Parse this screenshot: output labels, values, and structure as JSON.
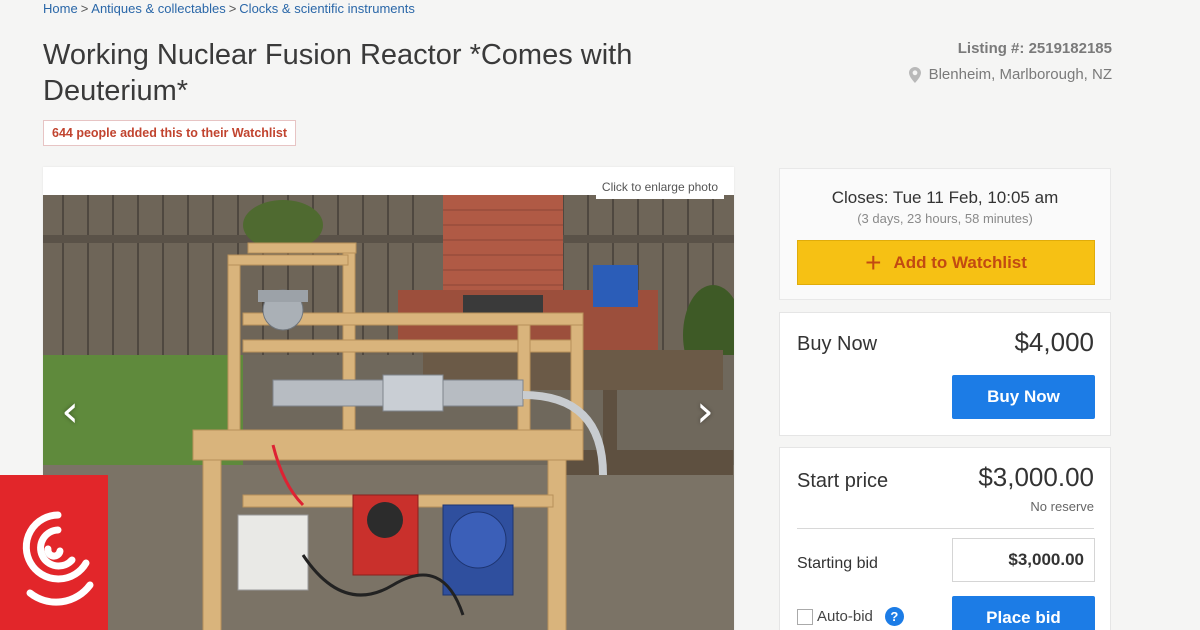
{
  "breadcrumb": {
    "items": [
      "Home",
      "Antiques & collectables",
      "Clocks & scientific instruments"
    ],
    "separator": ">"
  },
  "listing": {
    "title": "Working Nuclear Fusion Reactor *Comes with Deuterium*",
    "watchlist_count_text": "644 people added this to their Watchlist",
    "listing_number": "Listing #: 2519182185",
    "location": "Blenheim, Marlborough, NZ"
  },
  "photo": {
    "enlarge_label": "Click to enlarge photo",
    "prev_glyph": "‹",
    "next_glyph": "›"
  },
  "closing": {
    "closes_text": "Closes: Tue 11 Feb, 10:05 am",
    "remaining_text": "(3 days, 23 hours, 58 minutes)",
    "watch_button_label": "Add to Watchlist",
    "watch_button_icon": "+"
  },
  "buy_now": {
    "label": "Buy Now",
    "price": "$4,000",
    "button_label": "Buy Now"
  },
  "bidding": {
    "start_label": "Start price",
    "start_price": "$3,000.00",
    "reserve_text": "No reserve",
    "starting_bid_label": "Starting bid",
    "starting_bid_value": "$3,000.00",
    "auto_bid_label": "Auto-bid",
    "help_glyph": "?",
    "place_bid_label": "Place bid"
  },
  "colors": {
    "link": "#2a67a8",
    "watch_button": "#f6c114",
    "primary_button": "#1c7ce6",
    "badge_text": "#c1442f",
    "logo_bg": "#e2262a"
  }
}
